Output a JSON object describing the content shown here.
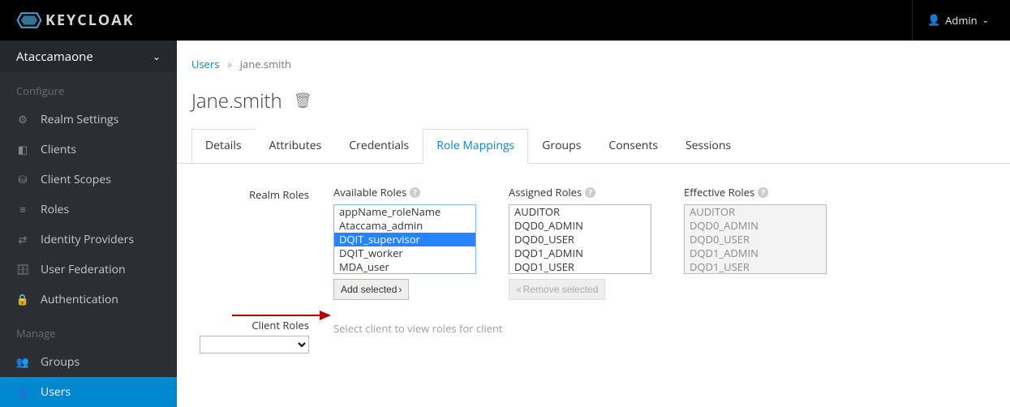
{
  "brand": "KEYCLOAK",
  "user_label": "Admin",
  "realm_selector": "Ataccamaone",
  "sidebar": {
    "section_configure": "Configure",
    "section_manage": "Manage",
    "configure_items": [
      {
        "icon": "sliders",
        "label": "Realm Settings"
      },
      {
        "icon": "cube",
        "label": "Clients"
      },
      {
        "icon": "scopes",
        "label": "Client Scopes"
      },
      {
        "icon": "list",
        "label": "Roles"
      },
      {
        "icon": "swap",
        "label": "Identity Providers"
      },
      {
        "icon": "db",
        "label": "User Federation"
      },
      {
        "icon": "lock",
        "label": "Authentication"
      }
    ],
    "manage_items": [
      {
        "icon": "group",
        "label": "Groups",
        "active": false
      },
      {
        "icon": "user",
        "label": "Users",
        "active": true
      }
    ]
  },
  "breadcrumb": {
    "root": "Users",
    "current": "jane.smith"
  },
  "page_title": "Jane.smith",
  "tabs": [
    {
      "label": "Details",
      "active": false
    },
    {
      "label": "Attributes",
      "active": false
    },
    {
      "label": "Credentials",
      "active": false
    },
    {
      "label": "Role Mappings",
      "active": true
    },
    {
      "label": "Groups",
      "active": false
    },
    {
      "label": "Consents",
      "active": false
    },
    {
      "label": "Sessions",
      "active": false
    }
  ],
  "role_mappings": {
    "realm_roles_label": "Realm Roles",
    "client_roles_label": "Client Roles",
    "available_label": "Available Roles",
    "assigned_label": "Assigned Roles",
    "effective_label": "Effective Roles",
    "add_selected_label": "Add selected",
    "remove_selected_label": "Remove selected",
    "client_hint": "Select client to view roles for client",
    "available": [
      {
        "label": "appName_roleName",
        "selected": false
      },
      {
        "label": "Ataccama_admin",
        "selected": false
      },
      {
        "label": "DQIT_supervisor",
        "selected": true
      },
      {
        "label": "DQIT_worker",
        "selected": false
      },
      {
        "label": "MDA_user",
        "selected": false
      }
    ],
    "assigned": [
      "AUDITOR",
      "DQD0_ADMIN",
      "DQD0_USER",
      "DQD1_ADMIN",
      "DQD1_USER"
    ],
    "effective": [
      "AUDITOR",
      "DQD0_ADMIN",
      "DQD0_USER",
      "DQD1_ADMIN",
      "DQD1_USER"
    ]
  }
}
